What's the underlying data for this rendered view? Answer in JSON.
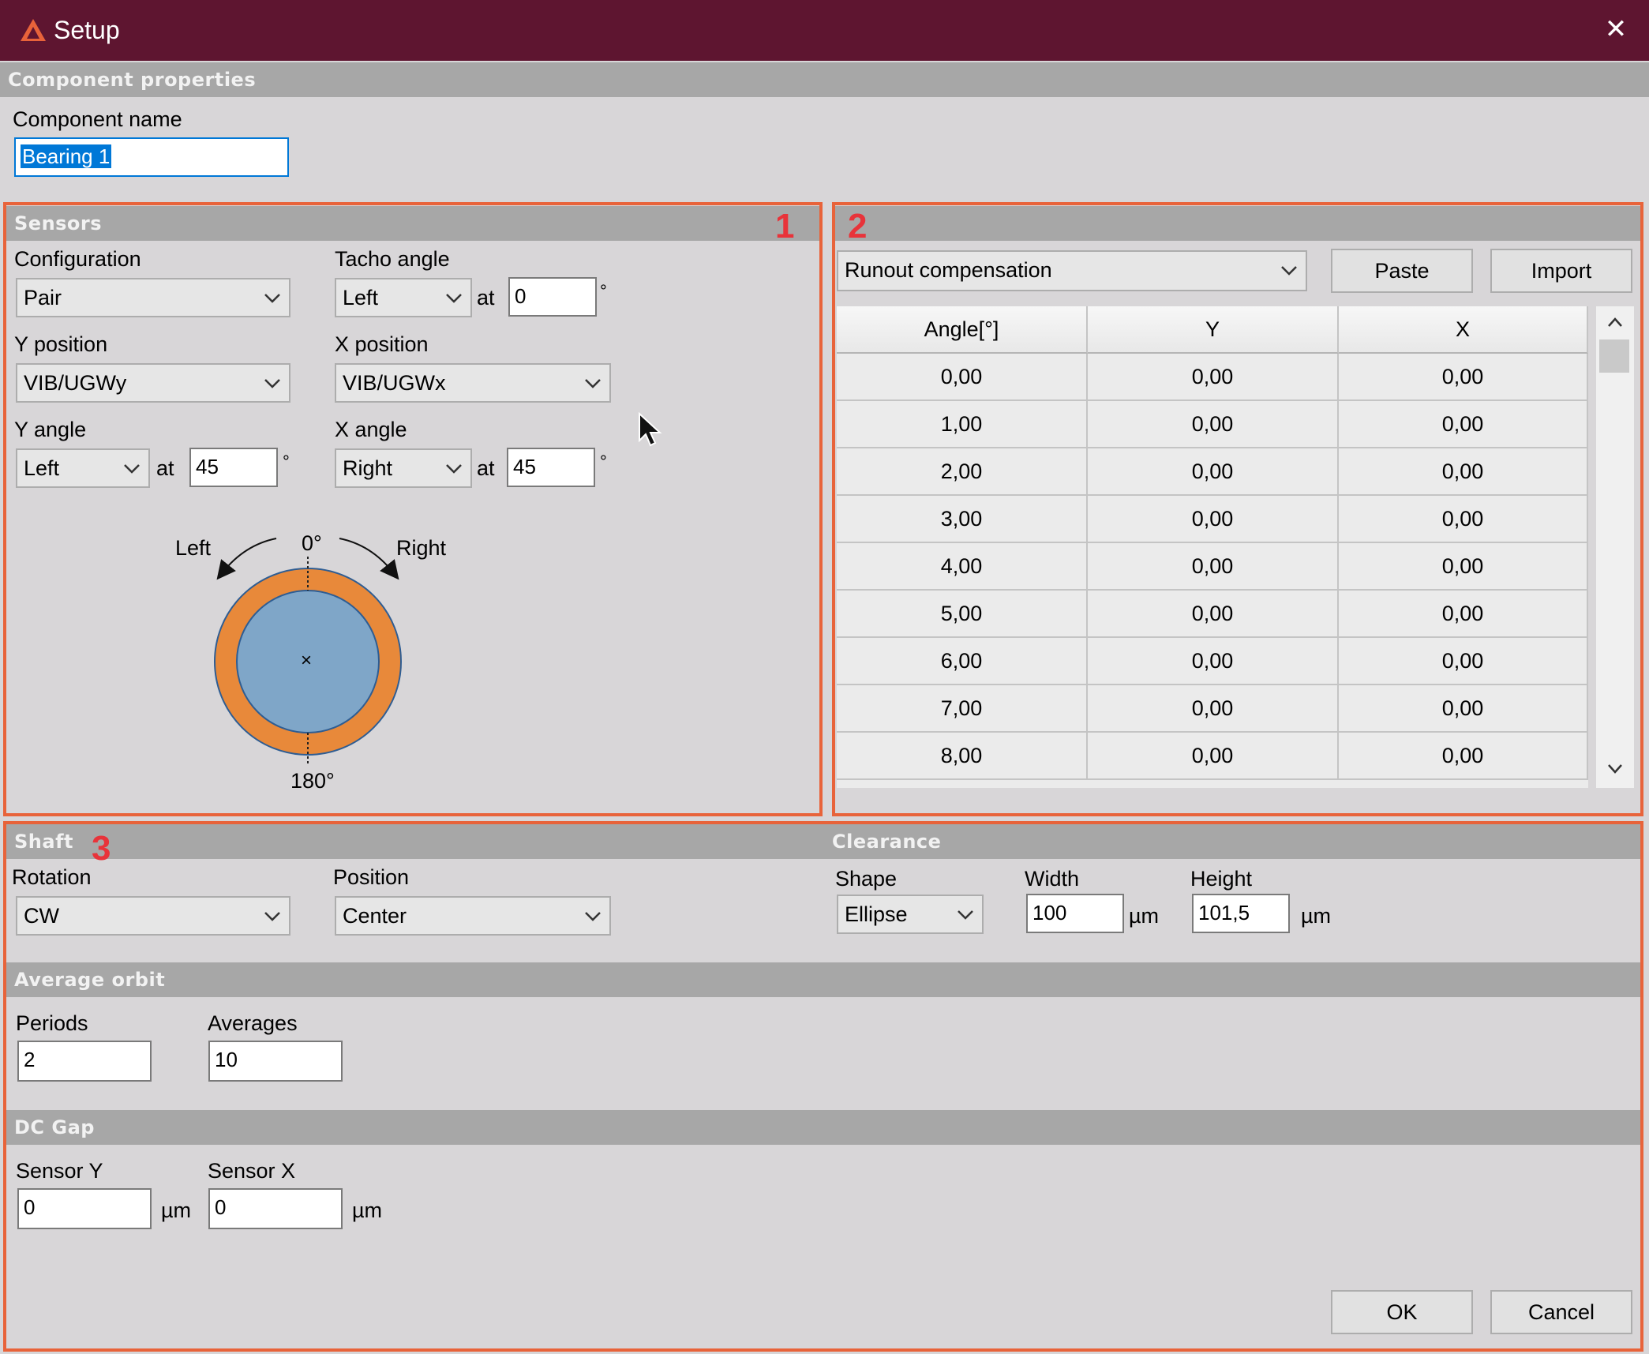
{
  "window": {
    "title": "Setup",
    "close_glyph": "✕"
  },
  "component_properties": {
    "header": "Component properties",
    "name_label": "Component name",
    "name_value": "Bearing 1"
  },
  "annotations": {
    "one": "1",
    "two": "2",
    "three": "3"
  },
  "sensors": {
    "header": "Sensors",
    "configuration": {
      "label": "Configuration",
      "value": "Pair"
    },
    "tacho_angle": {
      "label": "Tacho angle",
      "value": "Left",
      "at": "at",
      "angle": "0",
      "unit": "°"
    },
    "y_position": {
      "label": "Y position",
      "value": "VIB/UGWy"
    },
    "x_position": {
      "label": "X position",
      "value": "VIB/UGWx"
    },
    "y_angle": {
      "label": "Y angle",
      "value": "Left",
      "at": "at",
      "angle": "45",
      "unit": "°"
    },
    "x_angle": {
      "label": "X angle",
      "value": "Right",
      "at": "at",
      "angle": "45",
      "unit": "°"
    },
    "diagram": {
      "left": "Left",
      "right": "Right",
      "top": "0°",
      "bottom": "180°",
      "center": "×"
    }
  },
  "runout": {
    "mode": "Runout compensation",
    "paste_label": "Paste",
    "import_label": "Import",
    "columns": [
      "Angle[°]",
      "Y",
      "X"
    ],
    "rows": [
      [
        "0,00",
        "0,00",
        "0,00"
      ],
      [
        "1,00",
        "0,00",
        "0,00"
      ],
      [
        "2,00",
        "0,00",
        "0,00"
      ],
      [
        "3,00",
        "0,00",
        "0,00"
      ],
      [
        "4,00",
        "0,00",
        "0,00"
      ],
      [
        "5,00",
        "0,00",
        "0,00"
      ],
      [
        "6,00",
        "0,00",
        "0,00"
      ],
      [
        "7,00",
        "0,00",
        "0,00"
      ],
      [
        "8,00",
        "0,00",
        "0,00"
      ]
    ]
  },
  "shaft": {
    "header": "Shaft",
    "rotation": {
      "label": "Rotation",
      "value": "CW"
    },
    "position": {
      "label": "Position",
      "value": "Center"
    }
  },
  "clearance": {
    "header": "Clearance",
    "shape": {
      "label": "Shape",
      "value": "Ellipse"
    },
    "width": {
      "label": "Width",
      "value": "100",
      "unit": "µm"
    },
    "height": {
      "label": "Height",
      "value": "101,5",
      "unit": "µm"
    }
  },
  "average_orbit": {
    "header": "Average orbit",
    "periods": {
      "label": "Periods",
      "value": "2"
    },
    "averages": {
      "label": "Averages",
      "value": "10"
    }
  },
  "dc_gap": {
    "header": "DC Gap",
    "sensor_y": {
      "label": "Sensor Y",
      "value": "0",
      "unit": "µm"
    },
    "sensor_x": {
      "label": "Sensor X",
      "value": "0",
      "unit": "µm"
    }
  },
  "footer": {
    "ok_label": "OK",
    "cancel_label": "Cancel"
  }
}
